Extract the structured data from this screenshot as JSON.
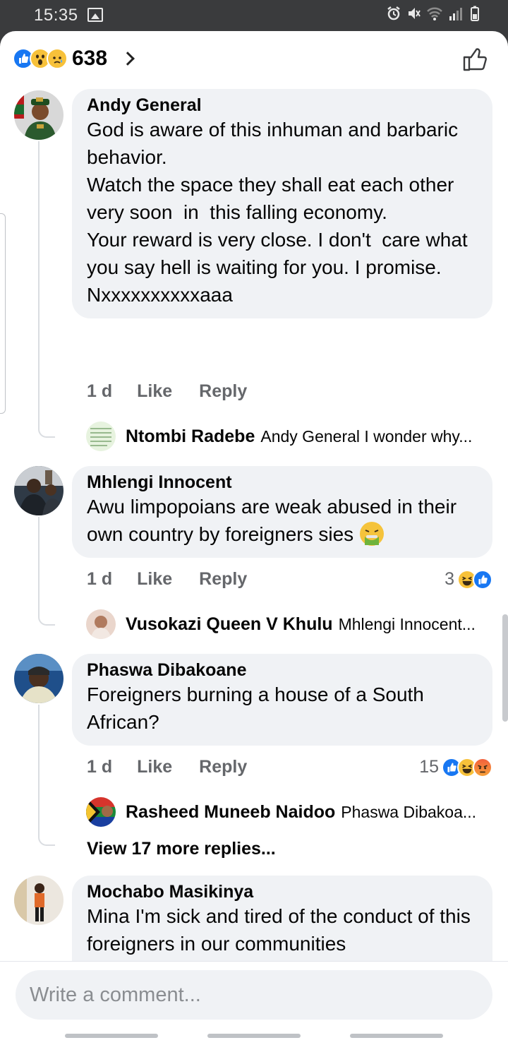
{
  "status_bar": {
    "time": "15:35"
  },
  "header": {
    "reaction_count": "638"
  },
  "comments": [
    {
      "author": "Andy General",
      "text": "God is aware of this inhuman and barbaric behavior.\nWatch the space they shall eat each other very soon  in  this falling economy.\nYour reward is very close. I don't  care what you say hell is waiting for you. I promise.\nNxxxxxxxxxxaaa",
      "time": "1 d",
      "like": "Like",
      "reply": "Reply",
      "reply_preview": {
        "author": "Ntombi Radebe",
        "text": "Andy General I wonder why..."
      }
    },
    {
      "author": "Mhlengi Innocent",
      "text": "Awu limpopoians are weak abused in their own country by foreigners sies",
      "time": "1 d",
      "like": "Like",
      "reply": "Reply",
      "reaction_count": "3",
      "reply_preview": {
        "author": "Vusokazi Queen V Khulu",
        "text": "Mhlengi Innocent..."
      }
    },
    {
      "author": "Phaswa Dibakoane",
      "text": "Foreigners burning a house of a South African?",
      "time": "1 d",
      "like": "Like",
      "reply": "Reply",
      "reaction_count": "15",
      "reply_preview": {
        "author": "Rasheed Muneeb Naidoo",
        "text": "Phaswa Dibakoa..."
      },
      "view_more": "View 17 more replies..."
    },
    {
      "author": "Mochabo Masikinya",
      "text": "Mina I'm sick and tired of the conduct of this foreigners in our communities"
    }
  ],
  "composer": {
    "placeholder": "Write a comment..."
  },
  "colors": {
    "like_blue": "#1877f2",
    "bubble_bg": "#f0f2f5",
    "meta_gray": "#65676b",
    "status_bg": "#3a3b3d"
  },
  "icons": [
    "gallery-icon",
    "alarm-icon",
    "mute-icon",
    "wifi-icon",
    "signal-icon",
    "battery-icon",
    "like-reaction-icon",
    "wow-reaction-icon",
    "sad-reaction-icon",
    "haha-reaction-icon",
    "angry-reaction-icon",
    "thumbs-up-outline-icon",
    "chevron-right-icon",
    "puke-emoji-icon"
  ]
}
